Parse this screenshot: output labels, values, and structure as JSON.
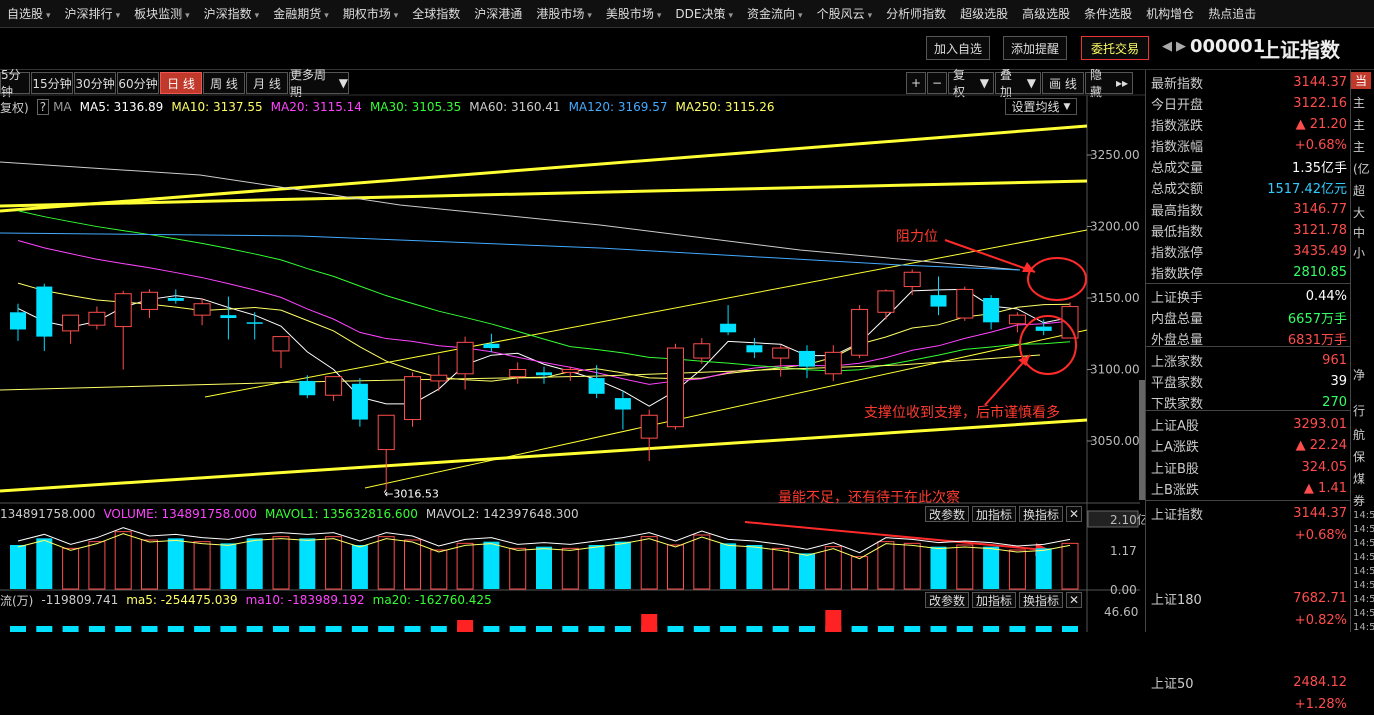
{
  "menu": [
    {
      "label": "自选股",
      "dd": true
    },
    {
      "label": "沪深排行",
      "dd": true
    },
    {
      "label": "板块监测",
      "dd": true
    },
    {
      "label": "沪深指数",
      "dd": true
    },
    {
      "label": "金融期货",
      "dd": true
    },
    {
      "label": "期权市场",
      "dd": true
    },
    {
      "label": "全球指数",
      "dd": false
    },
    {
      "label": "沪深港通",
      "dd": false
    },
    {
      "label": "港股市场",
      "dd": true
    },
    {
      "label": "美股市场",
      "dd": true
    },
    {
      "label": "DDE决策",
      "dd": true
    },
    {
      "label": "资金流向",
      "dd": true
    },
    {
      "label": "个股风云",
      "dd": true
    },
    {
      "label": "分析师指数",
      "dd": false
    },
    {
      "label": "超级选股",
      "dd": false
    },
    {
      "label": "高级选股",
      "dd": false
    },
    {
      "label": "条件选股",
      "dd": false
    },
    {
      "label": "机构增仓",
      "dd": false
    },
    {
      "label": "热点追击",
      "dd": false
    }
  ],
  "toolbar": {
    "add_watch": "加入自选",
    "add_alert": "添加提醒",
    "trade": "委托交易"
  },
  "stock": {
    "code": "000001",
    "name": "上证指数"
  },
  "periods": [
    "5分钟",
    "15分钟",
    "30分钟",
    "60分钟",
    "日 线",
    "周 线",
    "月 线",
    "更多周期"
  ],
  "active_period": 4,
  "right_tools": {
    "plus": "+",
    "minus": "−",
    "fq": "复权",
    "overlay": "叠加",
    "draw": "画 线",
    "hide": "隐藏"
  },
  "ma_line": {
    "fq_label": "复权)",
    "ma_label": "MA",
    "ma5": "MA5: 3136.89",
    "ma10": "MA10: 3137.55",
    "ma20": "MA20: 3115.14",
    "ma30": "MA30: 3105.35",
    "ma60": "MA60: 3160.41",
    "ma120": "MA120: 3169.57",
    "ma250": "MA250: 3115.26",
    "set_ma": "设置均线"
  },
  "price_axis": [
    "3250.00",
    "3200.00",
    "3150.00",
    "3100.00",
    "3050.00"
  ],
  "low_marker": "3016.53",
  "volume_line": {
    "v0": "134891758.000",
    "vol": "VOLUME: 134891758.000",
    "mavol1": "MAVOL1: 135632816.600",
    "mavol2": "MAVOL2: 142397648.300"
  },
  "vol_axis": [
    "2.10亿",
    "1.17",
    "0.00"
  ],
  "flow_line": {
    "name": "流(万)",
    "v": "-119809.741",
    "ma5": "ma5: -254475.039",
    "ma10": "ma10: -183989.192",
    "ma20": "ma20: -162760.425"
  },
  "flow_axis": "46.60",
  "sub_tools": {
    "change": "改参数",
    "add": "加指标",
    "swap": "换指标",
    "close": "✕"
  },
  "annotations": {
    "resistance": "阻力位",
    "support": "支撑位收到支撑，后市谨慎看多",
    "volume": "量能不足，还有待于在此次察"
  },
  "panel": [
    {
      "l": "最新指数",
      "v": "3144.37",
      "c": "#ff4d4d"
    },
    {
      "l": "今日开盘",
      "v": "3122.16",
      "c": "#ff4d4d"
    },
    {
      "l": "指数涨跌",
      "v": "▲ 21.20",
      "c": "#ff4d4d"
    },
    {
      "l": "指数涨幅",
      "v": "+0.68%",
      "c": "#ff4d4d"
    },
    {
      "l": "总成交量",
      "v": "1.35亿手",
      "c": "#ffffff"
    },
    {
      "l": "总成交额",
      "v": "1517.42亿元",
      "c": "#33ccff"
    },
    {
      "l": "最高指数",
      "v": "3146.77",
      "c": "#ff4d4d"
    },
    {
      "l": "最低指数",
      "v": "3121.78",
      "c": "#ff4d4d"
    },
    {
      "l": "指数涨停",
      "v": "3435.49",
      "c": "#ff4d4d"
    },
    {
      "l": "指数跌停",
      "v": "2810.85",
      "c": "#33ff66"
    },
    {
      "l": "上证换手",
      "v": "0.44%",
      "c": "#ffffff"
    },
    {
      "l": "内盘总量",
      "v": "6657万手",
      "c": "#33ff66"
    },
    {
      "l": "外盘总量",
      "v": "6831万手",
      "c": "#ff4d4d"
    },
    {
      "l": "上涨家数",
      "v": "961",
      "c": "#ff4d4d"
    },
    {
      "l": "平盘家数",
      "v": "39",
      "c": "#ffffff"
    },
    {
      "l": "下跌家数",
      "v": "270",
      "c": "#33ff66"
    },
    {
      "l": "上证A股",
      "v": "3293.01",
      "c": "#ff4d4d"
    },
    {
      "l": "上A涨跌",
      "v": "▲ 22.24",
      "c": "#ff4d4d"
    },
    {
      "l": "上证B股",
      "v": "324.05",
      "c": "#ff4d4d"
    },
    {
      "l": "上B涨跌",
      "v": "▲ 1.41",
      "c": "#ff4d4d"
    }
  ],
  "indices": [
    {
      "name": "上证指数",
      "val": "3144.37",
      "chg": "+0.68%"
    },
    {
      "name": "上证180",
      "val": "7682.71",
      "chg": "+0.82%"
    },
    {
      "name": "上证50",
      "val": "2484.12",
      "chg": "+1.28%"
    }
  ],
  "far_right": [
    "当",
    "主",
    "主",
    "主",
    "(亿",
    "超",
    "大",
    "中",
    "小",
    "净",
    "行",
    "航",
    "保",
    "煤",
    "券",
    "14:5",
    "14:5",
    "14:5",
    "14:5",
    "14:5",
    "14:5",
    "14:5",
    "14:5",
    "14:5"
  ],
  "colors": {
    "up": "#ff4d4d",
    "down": "#00e0ff",
    "ma5": "#ffffff",
    "ma10": "#ffff66",
    "ma20": "#ff44ff",
    "ma30": "#33ff33",
    "ma60": "#cccccc",
    "ma120": "#44aaff",
    "ma250": "#ffff66"
  },
  "candles": [
    {
      "o": 3140,
      "h": 3146,
      "l": 3120,
      "c": 3128
    },
    {
      "o": 3158,
      "h": 3160,
      "l": 3113,
      "c": 3123
    },
    {
      "o": 3127,
      "h": 3136,
      "l": 3118,
      "c": 3138
    },
    {
      "o": 3131,
      "h": 3144,
      "l": 3128,
      "c": 3140
    },
    {
      "o": 3130,
      "h": 3155,
      "l": 3100,
      "c": 3153
    },
    {
      "o": 3142,
      "h": 3156,
      "l": 3136,
      "c": 3154
    },
    {
      "o": 3150,
      "h": 3156,
      "l": 3146,
      "c": 3148
    },
    {
      "o": 3138,
      "h": 3150,
      "l": 3131,
      "c": 3146
    },
    {
      "o": 3138,
      "h": 3151,
      "l": 3121,
      "c": 3136
    },
    {
      "o": 3133,
      "h": 3140,
      "l": 3121,
      "c": 3132
    },
    {
      "o": 3113,
      "h": 3120,
      "l": 3101,
      "c": 3123
    },
    {
      "o": 3092,
      "h": 3096,
      "l": 3080,
      "c": 3082
    },
    {
      "o": 3082,
      "h": 3095,
      "l": 3078,
      "c": 3095
    },
    {
      "o": 3090,
      "h": 3094,
      "l": 3060,
      "c": 3065
    },
    {
      "o": 3044,
      "h": 3068,
      "l": 3016,
      "c": 3068
    },
    {
      "o": 3065,
      "h": 3098,
      "l": 3060,
      "c": 3095
    },
    {
      "o": 3092,
      "h": 3110,
      "l": 3085,
      "c": 3096
    },
    {
      "o": 3097,
      "h": 3123,
      "l": 3086,
      "c": 3119
    },
    {
      "o": 3118,
      "h": 3125,
      "l": 3112,
      "c": 3115
    },
    {
      "o": 3095,
      "h": 3105,
      "l": 3090,
      "c": 3100
    },
    {
      "o": 3098,
      "h": 3102,
      "l": 3090,
      "c": 3096
    },
    {
      "o": 3098,
      "h": 3102,
      "l": 3092,
      "c": 3100
    },
    {
      "o": 3094,
      "h": 3103,
      "l": 3080,
      "c": 3083
    },
    {
      "o": 3080,
      "h": 3085,
      "l": 3058,
      "c": 3072
    },
    {
      "o": 3052,
      "h": 3072,
      "l": 3036,
      "c": 3068
    },
    {
      "o": 3060,
      "h": 3118,
      "l": 3058,
      "c": 3115
    },
    {
      "o": 3108,
      "h": 3122,
      "l": 3104,
      "c": 3118
    },
    {
      "o": 3132,
      "h": 3145,
      "l": 3124,
      "c": 3126
    },
    {
      "o": 3117,
      "h": 3122,
      "l": 3108,
      "c": 3112
    },
    {
      "o": 3108,
      "h": 3117,
      "l": 3095,
      "c": 3115
    },
    {
      "o": 3113,
      "h": 3117,
      "l": 3094,
      "c": 3102
    },
    {
      "o": 3097,
      "h": 3117,
      "l": 3092,
      "c": 3112
    },
    {
      "o": 3110,
      "h": 3145,
      "l": 3108,
      "c": 3142
    },
    {
      "o": 3140,
      "h": 3156,
      "l": 3135,
      "c": 3155
    },
    {
      "o": 3158,
      "h": 3170,
      "l": 3152,
      "c": 3168
    },
    {
      "o": 3152,
      "h": 3165,
      "l": 3138,
      "c": 3144
    },
    {
      "o": 3136,
      "h": 3158,
      "l": 3134,
      "c": 3156
    },
    {
      "o": 3150,
      "h": 3152,
      "l": 3128,
      "c": 3133
    },
    {
      "o": 3132,
      "h": 3140,
      "l": 3126,
      "c": 3138
    },
    {
      "o": 3130,
      "h": 3135,
      "l": 3124,
      "c": 3127
    },
    {
      "o": 3122,
      "h": 3147,
      "l": 3122,
      "c": 3144
    }
  ],
  "volumes": [
    1.35,
    1.55,
    1.25,
    1.45,
    1.75,
    1.5,
    1.55,
    1.45,
    1.4,
    1.55,
    1.6,
    1.55,
    1.6,
    1.35,
    1.6,
    1.5,
    1.2,
    1.4,
    1.45,
    1.25,
    1.3,
    1.25,
    1.35,
    1.45,
    1.6,
    1.35,
    1.65,
    1.4,
    1.35,
    1.25,
    1.1,
    1.3,
    1.0,
    1.45,
    1.4,
    1.3,
    1.35,
    1.3,
    1.2,
    1.25,
    1.4
  ],
  "flows": [
    0,
    0,
    0,
    0,
    0,
    0,
    0,
    0,
    0,
    0,
    0,
    0,
    0,
    0,
    0,
    0,
    0,
    0,
    0,
    0,
    0,
    0,
    0,
    0,
    0,
    0,
    0,
    0,
    0,
    0,
    0,
    0,
    0,
    0,
    0,
    0,
    0,
    0,
    0,
    0,
    0
  ]
}
